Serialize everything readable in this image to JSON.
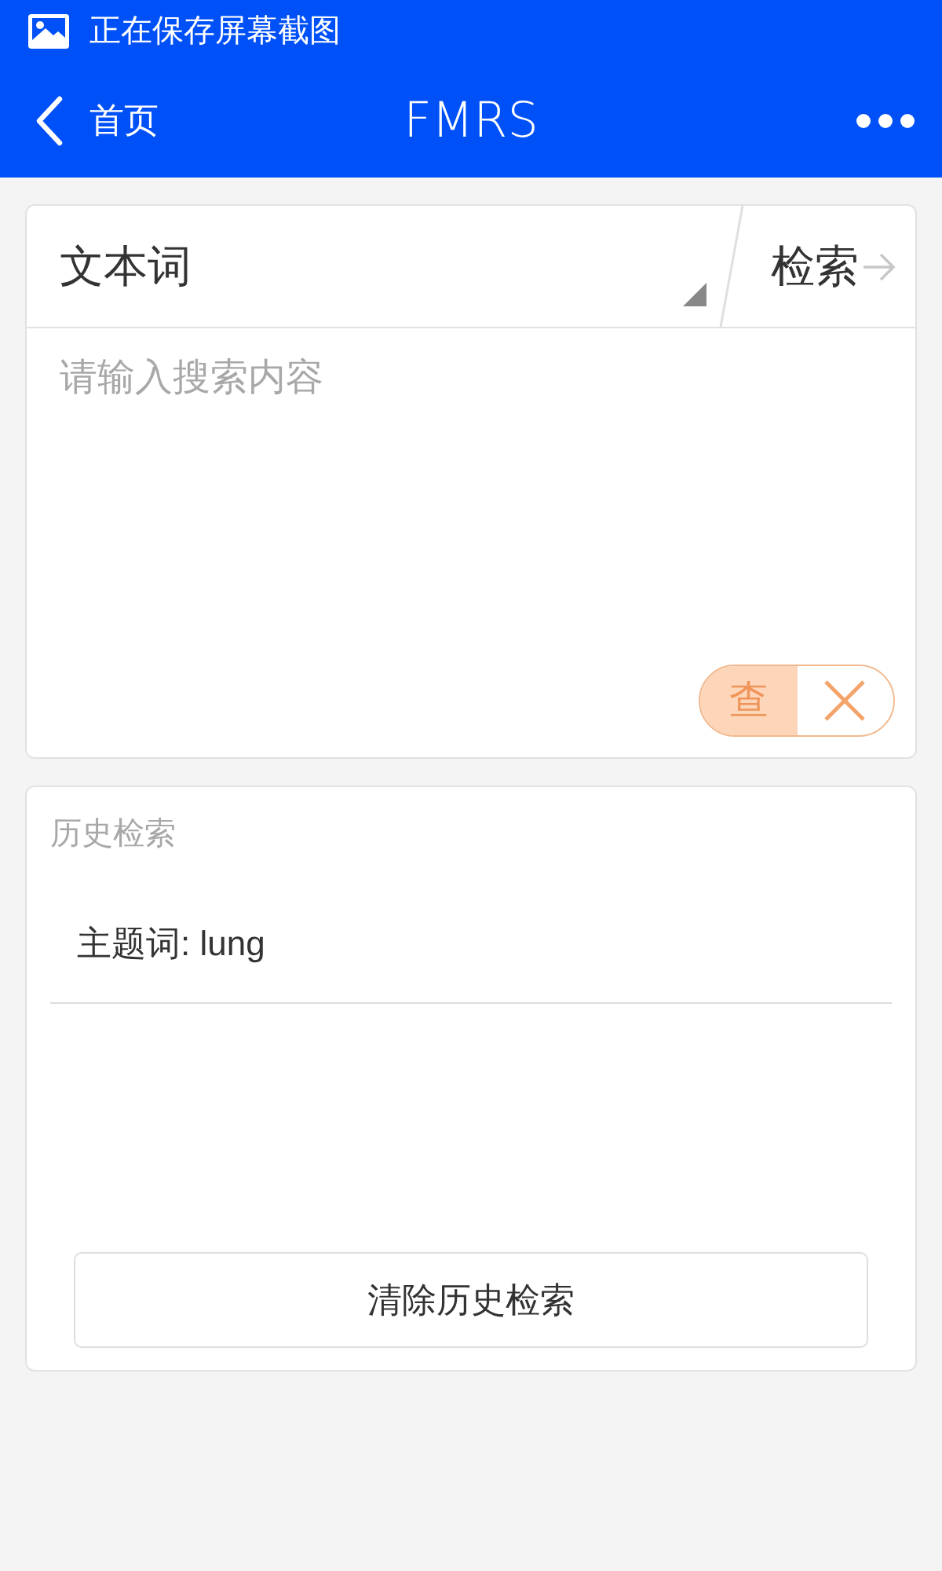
{
  "status_bar": {
    "text": "正在保存屏幕截图"
  },
  "nav_bar": {
    "back_label": "首页",
    "title": "FMRS"
  },
  "search_card": {
    "field_type": "文本词",
    "search_button": "检索",
    "query": {
      "placeholder": "请输入搜索内容"
    },
    "mode_toggle": [
      {
        "kind": "text",
        "label": "查",
        "selected": true
      },
      {
        "kind": "clear",
        "selected": false
      }
    ]
  },
  "history": {
    "title": "历史检索",
    "items": [
      {
        "label": "主题词: lung"
      }
    ],
    "clear_button": "清除历史检索"
  }
}
